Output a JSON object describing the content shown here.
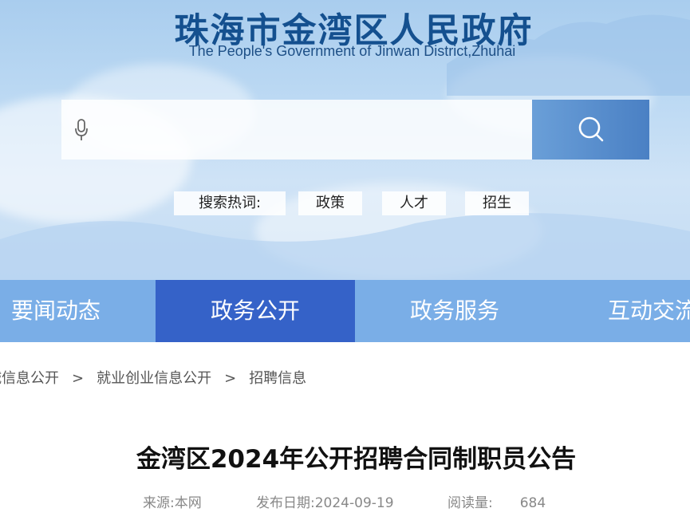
{
  "header": {
    "title": "珠海市金湾区人民政府",
    "subtitle": "The People's Government of Jinwan District,Zhuhai"
  },
  "search": {
    "placeholder": "",
    "mic_icon": "microphone-icon",
    "button_icon": "search-icon"
  },
  "hot_words": {
    "label": "搜索热词:",
    "tags": [
      "政策",
      "人才",
      "招生"
    ]
  },
  "nav": {
    "items": [
      "要闻动态",
      "政务公开",
      "政务服务",
      "互动交流"
    ],
    "active_index": 1
  },
  "breadcrumb": {
    "items": [
      "诚信息公开",
      "就业创业信息公开",
      "招聘信息"
    ],
    "separator": ">"
  },
  "article": {
    "title": "金湾区2024年公开招聘合同制职员公告",
    "source_label": "来源:",
    "source_value": "本网",
    "date_label": "发布日期:",
    "date_value": "2024-09-19",
    "views_label": "阅读量:",
    "views_value": "684"
  },
  "colors": {
    "nav_bg": "#7aaee7",
    "nav_active": "#3562c8",
    "title_blue": "#14508f"
  }
}
